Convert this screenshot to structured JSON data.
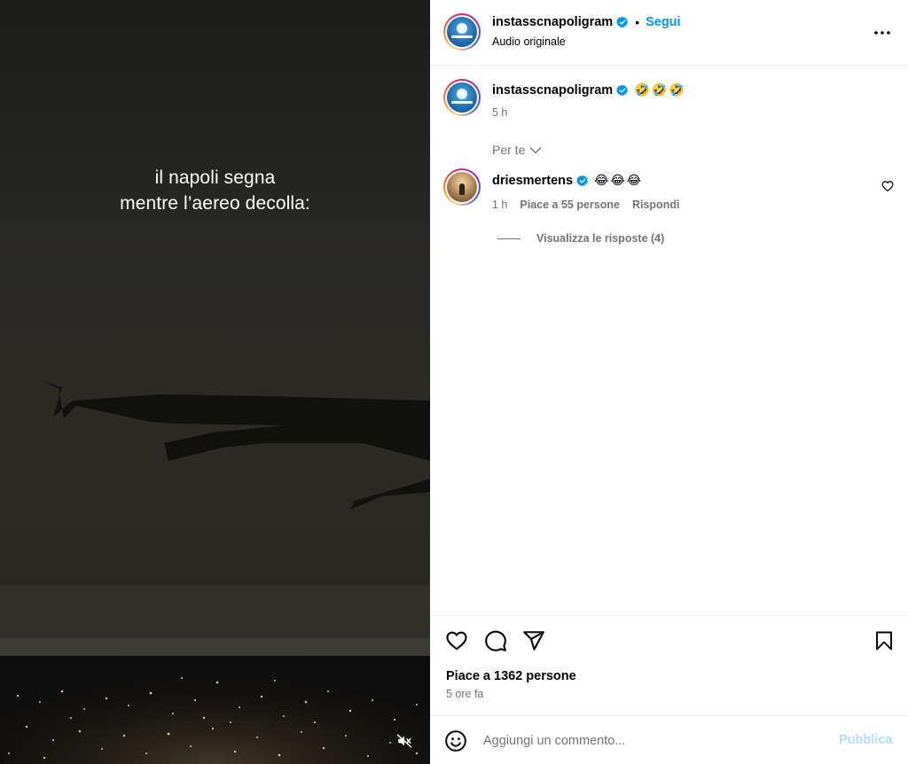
{
  "media": {
    "overlay_lines": [
      "il napoli segna",
      "mentre l’aereo decolla:"
    ],
    "mute_icon": "speaker-muted-icon"
  },
  "header": {
    "username": "instasscnapoligram",
    "separator": "•",
    "follow_label": "Segui",
    "audio_label": "Audio originale",
    "more_icon": "more-horizontal-icon"
  },
  "caption": {
    "username": "instasscnapoligram",
    "text": "🤣🤣🤣",
    "time": "5 h"
  },
  "comments_filter": {
    "label": "Per te"
  },
  "comment": {
    "username": "driesmertens",
    "text": "😂😂😂",
    "time": "1 h",
    "likes_label": "Piace a 55 persone",
    "reply_label": "Rispondi",
    "view_replies_label": "Visualizza le risposte (4)"
  },
  "actions": {
    "like_icon": "heart-icon",
    "comment_icon": "comment-icon",
    "share_icon": "share-icon",
    "save_icon": "bookmark-icon"
  },
  "stats": {
    "likes_label": "Piace a 1362 persone",
    "time_label": "5 ore fa"
  },
  "comment_bar": {
    "placeholder": "Aggiungi un commento...",
    "publish_label": "Pubblica"
  },
  "colors": {
    "accent": "#0095f6",
    "secondary_text": "#737373",
    "publish_disabled": "#b3dbff",
    "verified": "#0095f6"
  }
}
